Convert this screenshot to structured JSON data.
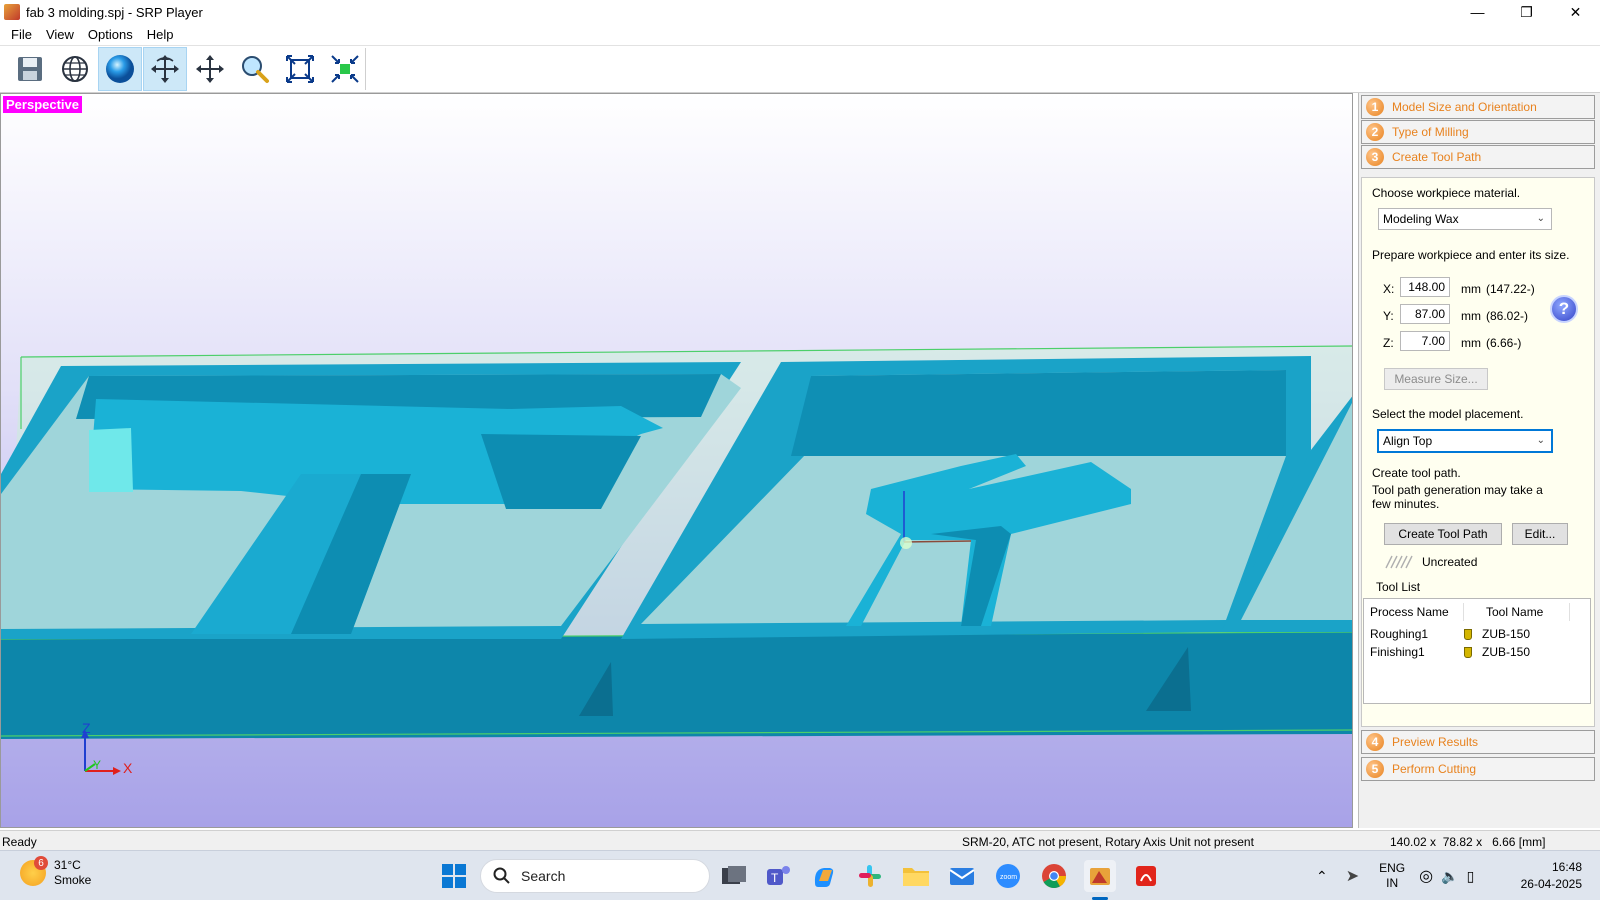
{
  "window": {
    "title": "fab 3 molding.spj - SRP Player",
    "controls": [
      "minimize-icon",
      "restore-icon",
      "close-icon"
    ]
  },
  "menu": [
    "File",
    "View",
    "Options",
    "Help"
  ],
  "toolbar": {
    "buttons": [
      {
        "icon": "save-icon",
        "active": false
      },
      {
        "icon": "globe-wireframe-icon",
        "active": false
      },
      {
        "icon": "sphere-shaded-icon",
        "active": true
      },
      {
        "icon": "rotate-icon",
        "active": true
      },
      {
        "icon": "move-icon",
        "active": false
      },
      {
        "icon": "zoom-icon",
        "active": false
      },
      {
        "icon": "fit-all-icon",
        "active": false
      },
      {
        "icon": "fit-selection-icon",
        "active": false
      }
    ]
  },
  "viewport": {
    "view_label": "Perspective",
    "axes": {
      "z": "Z",
      "y": "Y",
      "x": "X"
    },
    "colors": {
      "model": "#1a9ec0",
      "model_top": "#22b4d4",
      "floor": "#9ccfd6",
      "bg_bottom": "#a8a2e8",
      "highlight": "#ff00ff"
    }
  },
  "panel": {
    "steps": [
      {
        "num": "1",
        "label": "Model Size and Orientation"
      },
      {
        "num": "2",
        "label": "Type of Milling"
      },
      {
        "num": "3",
        "label": "Create Tool Path"
      },
      {
        "num": "4",
        "label": "Preview Results"
      },
      {
        "num": "5",
        "label": "Perform Cutting"
      }
    ],
    "material_prompt": "Choose workpiece material.",
    "material_value": "Modeling Wax",
    "size_prompt": "Prepare workpiece and enter its size.",
    "size": {
      "x": {
        "label": "X:",
        "value": "148.00",
        "unit": "mm",
        "min": "(147.22-)"
      },
      "y": {
        "label": "Y:",
        "value": "87.00",
        "unit": "mm",
        "min": "(86.02-)"
      },
      "z": {
        "label": "Z:",
        "value": "7.00",
        "unit": "mm",
        "min": "(6.66-)"
      }
    },
    "help_label": "?",
    "measure_button": "Measure Size...",
    "placement_prompt": "Select the model placement.",
    "placement_value": "Align Top",
    "toolpath_prompt": "Create tool path.",
    "toolpath_note": "Tool path generation may take a few minutes.",
    "create_button": "Create Tool Path",
    "edit_button": "Edit...",
    "toolpath_status": "Uncreated",
    "tool_list_label": "Tool List",
    "tool_list": {
      "headers": [
        "Process Name",
        "Tool Name"
      ],
      "rows": [
        {
          "process": "Roughing1",
          "tool": "ZUB-150"
        },
        {
          "process": "Finishing1",
          "tool": "ZUB-150"
        }
      ]
    }
  },
  "status": {
    "left": "Ready",
    "machine": "SRM-20, ATC not present, Rotary Axis Unit not present",
    "dims": "140.02 x  78.82 x   6.66 [mm]"
  },
  "taskbar": {
    "weather_temp": "31°C",
    "weather_desc": "Smoke",
    "weather_badge": "6",
    "search_label": "Search",
    "apps": [
      "start-icon",
      "task-view-icon",
      "teams-icon",
      "copilot-icon",
      "slack-icon",
      "file-explorer-icon",
      "mail-icon",
      "zoom-icon",
      "chrome-icon",
      "srp-player-icon",
      "acrobat-icon"
    ],
    "lang_line1": "ENG",
    "lang_line2": "IN",
    "time": "16:48",
    "date": "26-04-2025"
  }
}
